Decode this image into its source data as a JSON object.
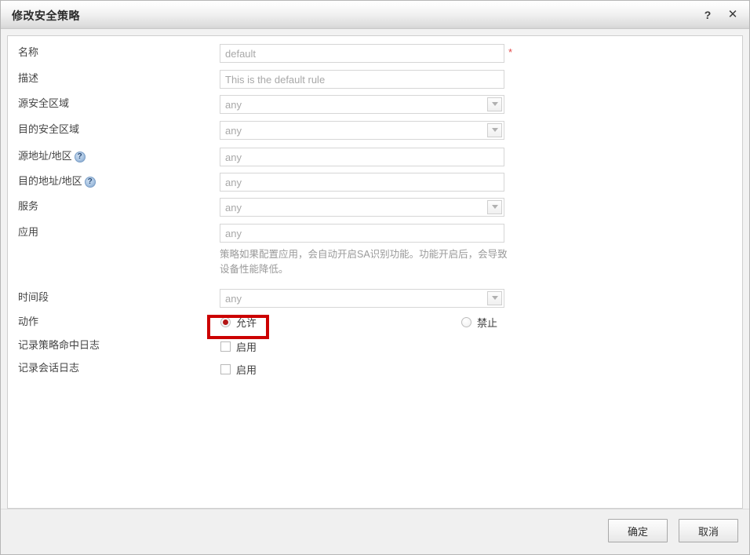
{
  "window": {
    "title": "修改安全策略",
    "help_icon": "question-mark-icon",
    "help_glyph": "?",
    "close_glyph": "✕"
  },
  "form": {
    "required_marker": "*",
    "fields": [
      {
        "label": "名称",
        "value": "default",
        "type": "text",
        "required": true,
        "help": false
      },
      {
        "label": "描述",
        "value": "This is the default rule",
        "type": "text",
        "required": false,
        "help": false
      },
      {
        "label": "源安全区域",
        "value": "any",
        "type": "select",
        "required": false,
        "help": false
      },
      {
        "label": "目的安全区域",
        "value": "any",
        "type": "select",
        "required": false,
        "help": false
      },
      {
        "label": "源地址/地区",
        "value": "any",
        "type": "text",
        "required": false,
        "help": true,
        "help_glyph": "?"
      },
      {
        "label": "目的地址/地区",
        "value": "any",
        "type": "text",
        "required": false,
        "help": true,
        "help_glyph": "?"
      },
      {
        "label": "服务",
        "value": "any",
        "type": "select",
        "required": false,
        "help": false
      },
      {
        "label": "应用",
        "value": "any",
        "type": "text",
        "required": false,
        "help": false
      }
    ],
    "hint": "策略如果配置应用，会自动开启SA识别功能。功能开启后，会导致设备性能降低。",
    "time_field": {
      "label": "时间段",
      "value": "any",
      "type": "select"
    },
    "action": {
      "label": "动作",
      "options": [
        {
          "label": "允许",
          "selected": true,
          "highlighted": true
        },
        {
          "label": "禁止",
          "selected": false,
          "highlighted": false
        }
      ]
    },
    "checkboxes": [
      {
        "label": "记录策略命中日志",
        "option_label": "启用",
        "checked": false
      },
      {
        "label": "记录会话日志",
        "option_label": "启用",
        "checked": false
      }
    ]
  },
  "footer": {
    "ok_label": "确定",
    "cancel_label": "取消"
  },
  "colors": {
    "highlight": "#cc0000",
    "radio_selected": "#b41616",
    "required": "#e24b4b",
    "help_icon": "#7e9fc6"
  }
}
